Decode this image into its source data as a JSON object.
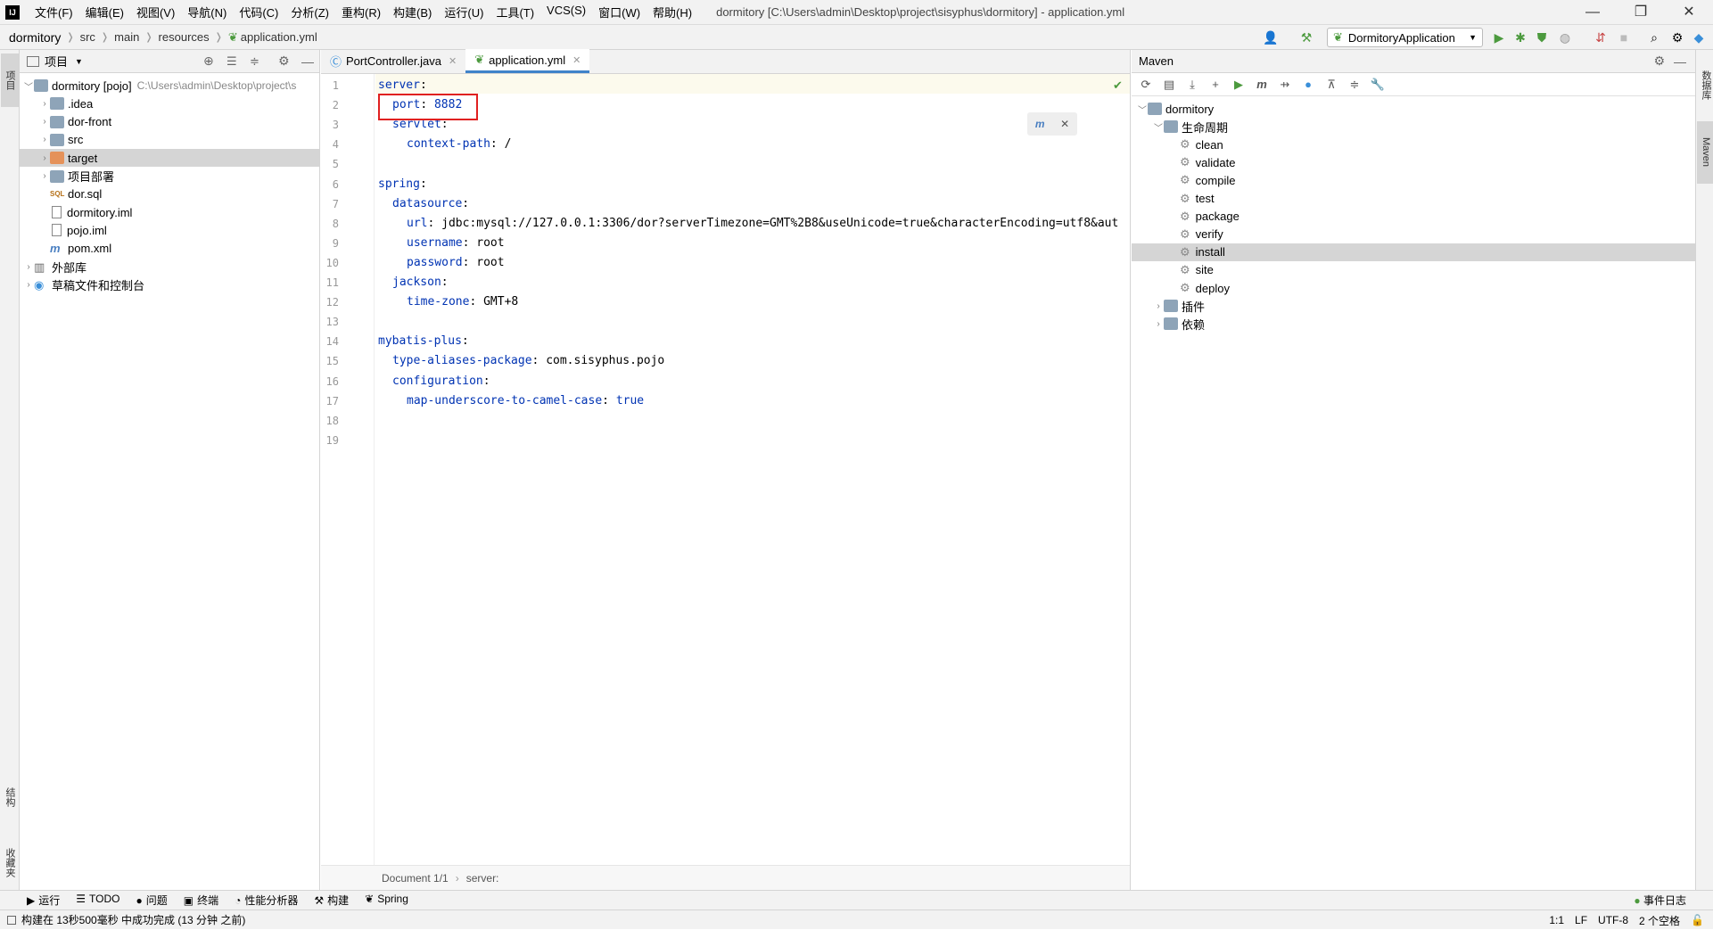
{
  "window": {
    "title": "dormitory [C:\\Users\\admin\\Desktop\\project\\sisyphus\\dormitory] - application.yml",
    "logo": "IJ",
    "menu": [
      "文件(F)",
      "编辑(E)",
      "视图(V)",
      "导航(N)",
      "代码(C)",
      "分析(Z)",
      "重构(R)",
      "构建(B)",
      "运行(U)",
      "工具(T)",
      "VCS(S)",
      "窗口(W)",
      "帮助(H)"
    ],
    "controls": {
      "minimize": "—",
      "restore": "❐",
      "close": "✕"
    }
  },
  "breadcrumb": {
    "root": "dormitory",
    "items": [
      "src",
      "main",
      "resources",
      "application.yml"
    ]
  },
  "toolbar": {
    "run_config": "DormitoryApplication"
  },
  "left_strip": {
    "project_tab": "项目",
    "structure_tab": "结构",
    "favorites_tab": "收藏夹"
  },
  "project_panel": {
    "title": "项目",
    "tree": [
      {
        "label": "dormitory [pojo]",
        "hint": "C:\\Users\\admin\\Desktop\\project\\s",
        "indent": 0,
        "arrow": "down",
        "icon": "module"
      },
      {
        "label": ".idea",
        "indent": 1,
        "arrow": "right",
        "icon": "folder"
      },
      {
        "label": "dor-front",
        "indent": 1,
        "arrow": "right",
        "icon": "folder"
      },
      {
        "label": "src",
        "indent": 1,
        "arrow": "right",
        "icon": "folder"
      },
      {
        "label": "target",
        "indent": 1,
        "arrow": "right",
        "icon": "folder-orange",
        "selected": true
      },
      {
        "label": "项目部署",
        "indent": 1,
        "arrow": "right",
        "icon": "folder"
      },
      {
        "label": "dor.sql",
        "indent": 1,
        "arrow": "",
        "icon": "sql"
      },
      {
        "label": "dormitory.iml",
        "indent": 1,
        "arrow": "",
        "icon": "file"
      },
      {
        "label": "pojo.iml",
        "indent": 1,
        "arrow": "",
        "icon": "file"
      },
      {
        "label": "pom.xml",
        "indent": 1,
        "arrow": "",
        "icon": "maven"
      },
      {
        "label": "外部库",
        "indent": 0,
        "arrow": "right",
        "icon": "lib"
      },
      {
        "label": "草稿文件和控制台",
        "indent": 0,
        "arrow": "right",
        "icon": "scratch"
      }
    ]
  },
  "editor": {
    "tabs": [
      {
        "label": "PortController.java",
        "active": false
      },
      {
        "label": "application.yml",
        "active": true
      }
    ],
    "lines": [
      {
        "n": "1",
        "key": "server",
        "sep": ":",
        "val": "",
        "indent": 0
      },
      {
        "n": "2",
        "key": "port",
        "sep": ": ",
        "val": "8882",
        "indent": 1
      },
      {
        "n": "3",
        "key": "servlet",
        "sep": ":",
        "val": "",
        "indent": 1
      },
      {
        "n": "4",
        "key": "context-path",
        "sep": ": ",
        "val": "/",
        "indent": 2
      },
      {
        "n": "5",
        "key": "",
        "sep": "",
        "val": "",
        "indent": 0
      },
      {
        "n": "6",
        "key": "spring",
        "sep": ":",
        "val": "",
        "indent": 0
      },
      {
        "n": "7",
        "key": "datasource",
        "sep": ":",
        "val": "",
        "indent": 1
      },
      {
        "n": "8",
        "key": "url",
        "sep": ": ",
        "val": "jdbc:mysql://127.0.0.1:3306/dor?serverTimezone=GMT%2B8&useUnicode=true&characterEncoding=utf8&aut",
        "indent": 2
      },
      {
        "n": "9",
        "key": "username",
        "sep": ": ",
        "val": "root",
        "indent": 2
      },
      {
        "n": "10",
        "key": "password",
        "sep": ": ",
        "val": "root",
        "indent": 2
      },
      {
        "n": "11",
        "key": "jackson",
        "sep": ":",
        "val": "",
        "indent": 1
      },
      {
        "n": "12",
        "key": "time-zone",
        "sep": ": ",
        "val": "GMT+8",
        "indent": 2
      },
      {
        "n": "13",
        "key": "",
        "sep": "",
        "val": "",
        "indent": 0
      },
      {
        "n": "14",
        "key": "mybatis-plus",
        "sep": ":",
        "val": "",
        "indent": 0
      },
      {
        "n": "15",
        "key": "type-aliases-package",
        "sep": ": ",
        "val": "com.sisyphus.pojo",
        "indent": 1
      },
      {
        "n": "16",
        "key": "configuration",
        "sep": ":",
        "val": "",
        "indent": 1
      },
      {
        "n": "17",
        "key": "map-underscore-to-camel-case",
        "sep": ": ",
        "val": "true",
        "indent": 2,
        "keyword": true
      },
      {
        "n": "18",
        "key": "",
        "sep": "",
        "val": "",
        "indent": 0
      },
      {
        "n": "19",
        "key": "",
        "sep": "",
        "val": "",
        "indent": 0
      }
    ],
    "status": {
      "doc": "Document 1/1",
      "path": "server:"
    }
  },
  "maven_panel": {
    "title": "Maven",
    "tree": [
      {
        "label": "dormitory",
        "indent": 0,
        "arrow": "down",
        "icon": "module"
      },
      {
        "label": "生命周期",
        "indent": 1,
        "arrow": "down",
        "icon": "folder"
      },
      {
        "label": "clean",
        "indent": 2,
        "arrow": "",
        "icon": "gear"
      },
      {
        "label": "validate",
        "indent": 2,
        "arrow": "",
        "icon": "gear"
      },
      {
        "label": "compile",
        "indent": 2,
        "arrow": "",
        "icon": "gear"
      },
      {
        "label": "test",
        "indent": 2,
        "arrow": "",
        "icon": "gear"
      },
      {
        "label": "package",
        "indent": 2,
        "arrow": "",
        "icon": "gear"
      },
      {
        "label": "verify",
        "indent": 2,
        "arrow": "",
        "icon": "gear"
      },
      {
        "label": "install",
        "indent": 2,
        "arrow": "",
        "icon": "gear",
        "selected": true
      },
      {
        "label": "site",
        "indent": 2,
        "arrow": "",
        "icon": "gear"
      },
      {
        "label": "deploy",
        "indent": 2,
        "arrow": "",
        "icon": "gear"
      },
      {
        "label": "插件",
        "indent": 1,
        "arrow": "right",
        "icon": "folder"
      },
      {
        "label": "依赖",
        "indent": 1,
        "arrow": "right",
        "icon": "folder"
      }
    ]
  },
  "right_strip": {
    "db_tab": "数据库",
    "maven_tab": "Maven"
  },
  "tool_windows": [
    {
      "label": "运行",
      "icon": "▶"
    },
    {
      "label": "TODO",
      "icon": "☰"
    },
    {
      "label": "问题",
      "icon": "●"
    },
    {
      "label": "终端",
      "icon": "▣"
    },
    {
      "label": "性能分析器",
      "icon": "◔"
    },
    {
      "label": "构建",
      "icon": "⚒"
    },
    {
      "label": "Spring",
      "icon": "❦"
    }
  ],
  "event_log": "事件日志",
  "status_bar": {
    "message": "构建在 13秒500毫秒 中成功完成 (13 分钟 之前)",
    "position": "1:1",
    "line_sep": "LF",
    "encoding": "UTF-8",
    "indent": "2 个空格"
  }
}
